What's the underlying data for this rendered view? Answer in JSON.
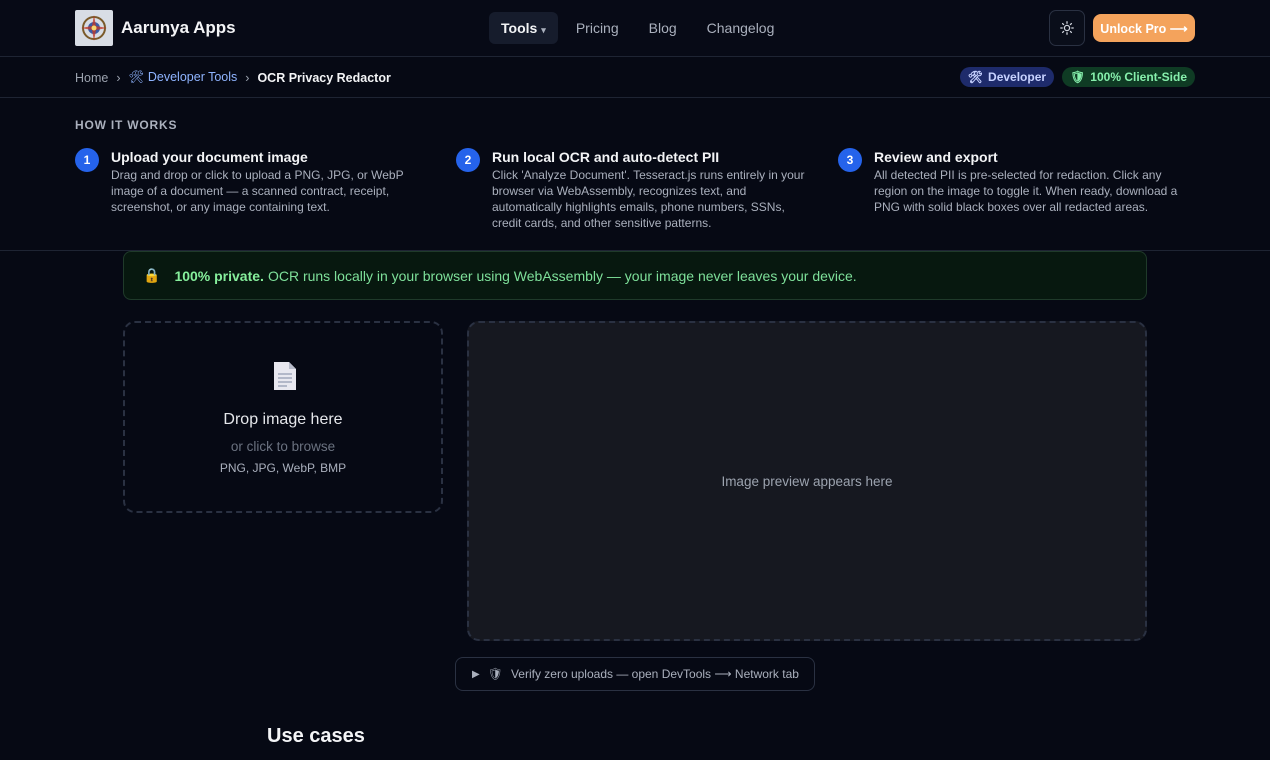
{
  "header": {
    "brand": "Aarunya Apps",
    "nav": [
      {
        "label": "Tools"
      },
      {
        "label": "Pricing"
      },
      {
        "label": "Blog"
      },
      {
        "label": "Changelog"
      }
    ],
    "unlock_label": "Unlock Pro ⟶"
  },
  "breadcrumb": {
    "home": "Home",
    "category": "Developer Tools",
    "current": "OCR Privacy Redactor",
    "separator": "›"
  },
  "badges": {
    "developer": "Developer",
    "client_side": "100% Client-Side"
  },
  "how_it_works": {
    "title": "HOW IT WORKS",
    "steps": [
      {
        "num": "1",
        "title": "Upload your document image",
        "desc": "Drag and drop or click to upload a PNG, JPG, or WebP image of a document — a scanned contract, receipt, screenshot, or any image containing text."
      },
      {
        "num": "2",
        "title": "Run local OCR and auto-detect PII",
        "desc": "Click 'Analyze Document'. Tesseract.js runs entirely in your browser via WebAssembly, recognizes text, and automatically highlights emails, phone numbers, SSNs, credit cards, and other sensitive patterns."
      },
      {
        "num": "3",
        "title": "Review and export",
        "desc": "All detected PII is pre-selected for redaction. Click any region on the image to toggle it. When ready, download a PNG with solid black boxes over all redacted areas."
      }
    ]
  },
  "privacy": {
    "bold": "100% private.",
    "text": "OCR runs locally in your browser using WebAssembly — your image never leaves your device."
  },
  "dropzone": {
    "title": "Drop image here",
    "subtitle": "or click to browse",
    "formats": "PNG, JPG, WebP, BMP"
  },
  "preview": {
    "placeholder": "Image preview appears here"
  },
  "verify": {
    "label": "Verify zero uploads — open DevTools ⟶ Network tab"
  },
  "use_cases": {
    "title": "Use cases"
  },
  "colors": {
    "background": "#060914",
    "accent_orange": "#f4a35c",
    "step_blue": "#2563eb",
    "privacy_green": "#86ef9c"
  }
}
